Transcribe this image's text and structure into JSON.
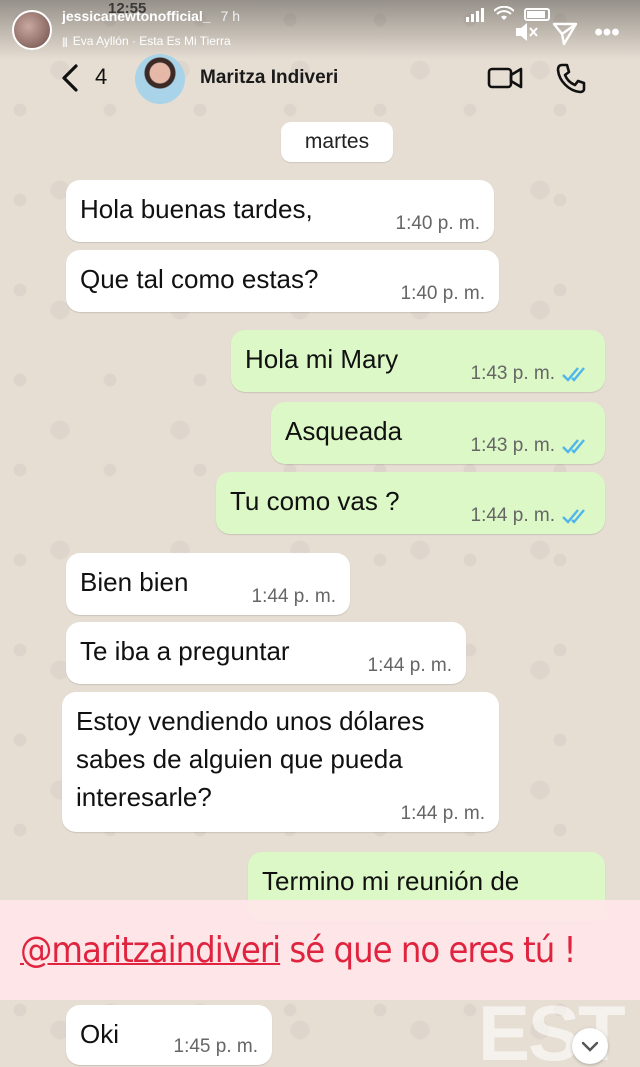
{
  "story": {
    "username": "jessicanewtonofficial_",
    "time_ago": "7 h",
    "music_bars": "|||",
    "music": "Eva Ayllón · Esta Es Mi Tierra",
    "clock": "12:55"
  },
  "chat": {
    "unread_count": "4",
    "contact_name": "Maritza Indiveri",
    "date_label": "martes"
  },
  "messages": [
    {
      "dir": "in",
      "text": "Hola buenas tardes,",
      "time": "1:40 p. m."
    },
    {
      "dir": "in",
      "text": "Que tal como estas?",
      "time": "1:40 p. m."
    },
    {
      "dir": "out",
      "text": "Hola mi Mary",
      "time": "1:43 p. m."
    },
    {
      "dir": "out",
      "text": "Asqueada",
      "time": "1:43 p. m."
    },
    {
      "dir": "out",
      "text": "Tu como vas ?",
      "time": "1:44 p. m."
    },
    {
      "dir": "in",
      "text": "Bien bien",
      "time": "1:44 p. m."
    },
    {
      "dir": "in",
      "text": "Te iba a preguntar",
      "time": "1:44 p. m."
    },
    {
      "dir": "in",
      "text": "Estoy vendiendo unos dólares\nsabes de alguien  que pueda\ninteresarle?",
      "time": "1:44 p. m."
    },
    {
      "dir": "out",
      "text": "Termino mi reunión de",
      "time": ""
    },
    {
      "dir": "in",
      "text": "Oki",
      "time": "1:45 p. m."
    }
  ],
  "caption": {
    "mention": "@maritzaindiveri",
    "text": " sé que no eres tú !"
  },
  "watermark": "EST",
  "colors": {
    "incoming": "#ffffff",
    "outgoing": "#dcf8c6",
    "read_ticks": "#4fb6ec",
    "caption": "#e0243f"
  }
}
